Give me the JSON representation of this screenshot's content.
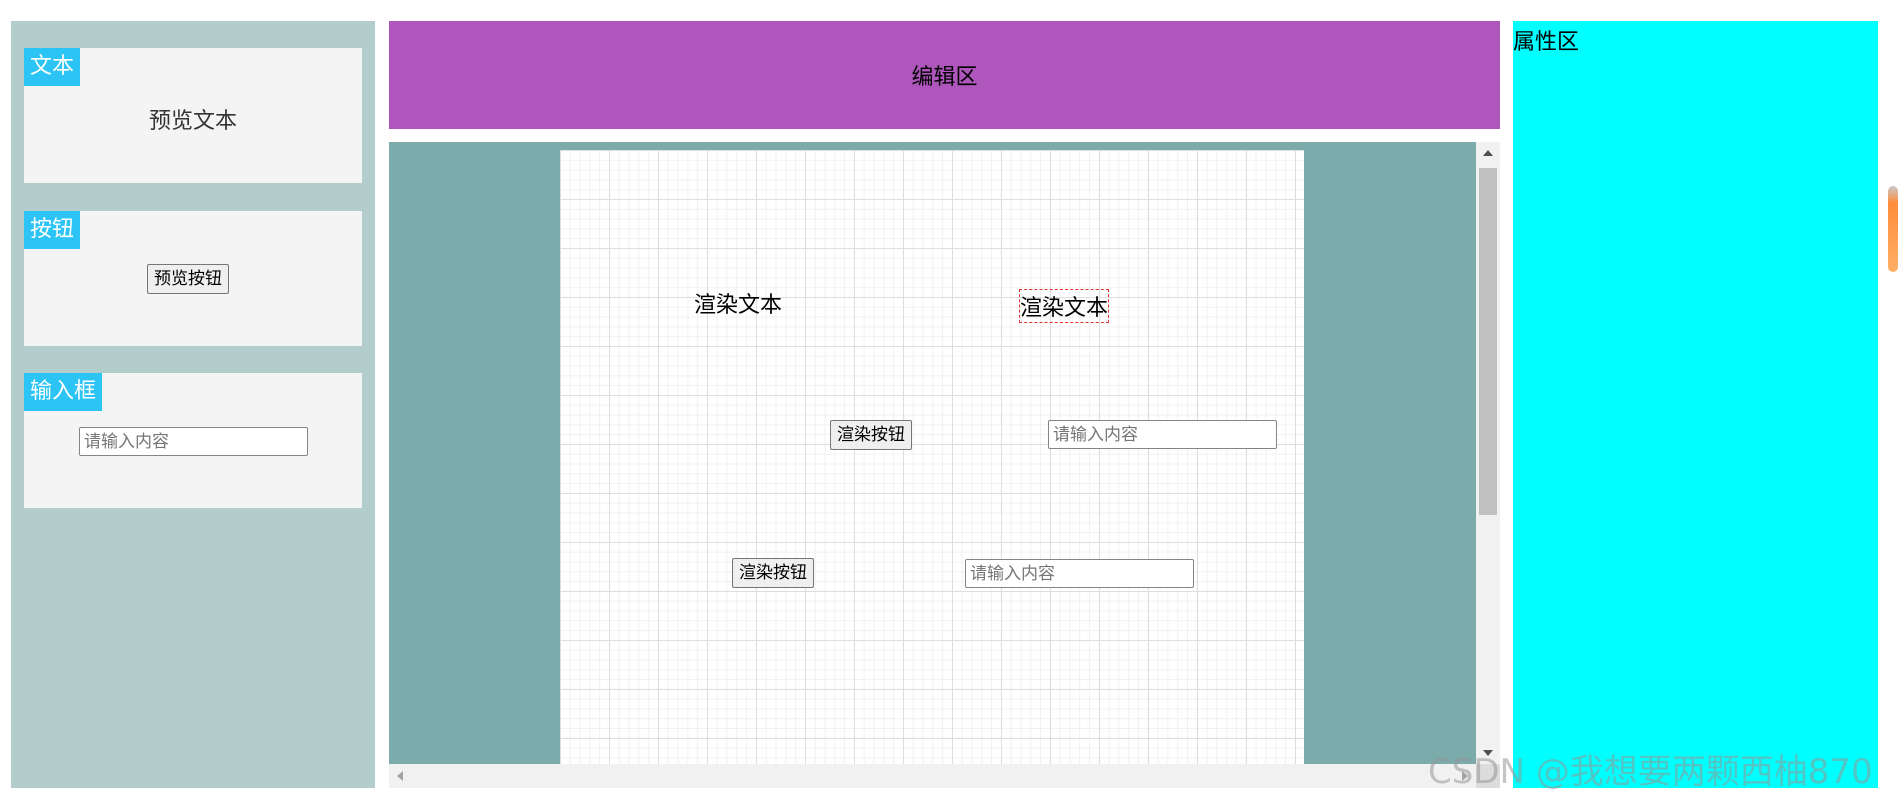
{
  "palette": {
    "text_card": {
      "tag": "文本",
      "preview": "预览文本"
    },
    "button_card": {
      "tag": "按钮",
      "preview_button": "预览按钮"
    },
    "input_card": {
      "tag": "输入框",
      "placeholder": "请输入内容"
    }
  },
  "editor": {
    "header_label": "编辑区",
    "canvas_items": [
      {
        "type": "text",
        "value": "渲染文本",
        "selected": false
      },
      {
        "type": "text",
        "value": "渲染文本",
        "selected": true
      },
      {
        "type": "button",
        "label": "渲染按钮"
      },
      {
        "type": "input",
        "placeholder": "请输入内容"
      },
      {
        "type": "button",
        "label": "渲染按钮"
      },
      {
        "type": "input",
        "placeholder": "请输入内容"
      }
    ]
  },
  "properties": {
    "title": "属性区"
  },
  "watermark": "CSDN @我想要两颗西柚870",
  "colors": {
    "palette_bg": "#b3cdcc",
    "card_bg": "#f4f4f4",
    "tag_bg": "#2cc4f4",
    "header_bg": "#af56bd",
    "canvas_area_bg": "#7babaa",
    "props_bg": "#00ffff",
    "selection_outline": "#e0332c"
  }
}
